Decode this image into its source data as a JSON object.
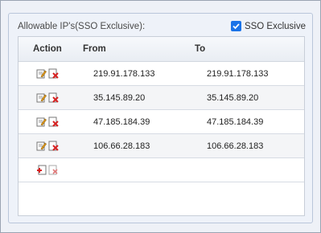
{
  "panel": {
    "title": "Allowable IP's(SSO Exclusive):",
    "sso_checkbox": {
      "label": "SSO Exclusive",
      "checked": true
    }
  },
  "table": {
    "headers": {
      "action": "Action",
      "from": "From",
      "to": "To"
    },
    "rows": [
      {
        "from": "219.91.178.133",
        "to": "219.91.178.133"
      },
      {
        "from": "35.145.89.20",
        "to": "35.145.89.20"
      },
      {
        "from": "47.185.184.39",
        "to": "47.185.184.39"
      },
      {
        "from": "106.66.28.183",
        "to": "106.66.28.183"
      }
    ],
    "row_action_icons": [
      "edit-icon",
      "delete-icon"
    ],
    "new_row_action_icons": [
      "add-icon",
      "cancel-icon"
    ]
  },
  "colors": {
    "accent": "#1a73e8",
    "delete": "#d62020",
    "edit": "#e8a020"
  }
}
